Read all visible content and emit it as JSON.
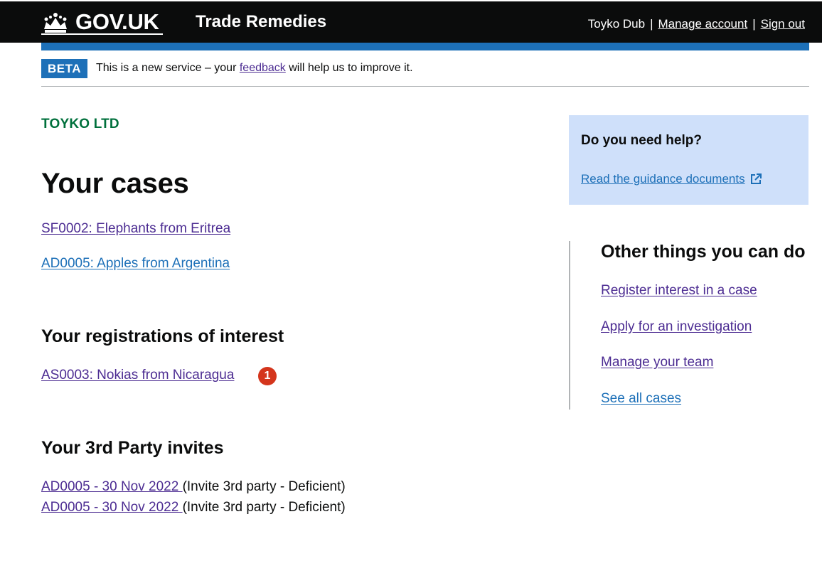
{
  "header": {
    "logo_text": "GOV.UK",
    "service_name": "Trade Remedies",
    "user_name": "Toyko Dub",
    "manage_account": "Manage account",
    "sign_out": "Sign out",
    "separator": "|"
  },
  "phase_banner": {
    "tag": "BETA",
    "text_before": "This is a new service – your ",
    "link": "feedback",
    "text_after": " will help us to improve it."
  },
  "organisation": "TOYKO LTD",
  "page_title": "Your cases",
  "cases": [
    {
      "label": "SF0002: Elephants from Eritrea",
      "visited": true
    },
    {
      "label": "AD0005: Apples from Argentina",
      "visited": false
    }
  ],
  "registrations": {
    "heading": "Your registrations of interest",
    "items": [
      {
        "label": "AS0003: Nokias from Nicaragua",
        "badge": "1"
      }
    ]
  },
  "invites": {
    "heading": "Your 3rd Party invites",
    "items": [
      {
        "link": "AD0005 - 30 Nov 2022 ",
        "status": "(Invite 3rd party - Deficient)"
      },
      {
        "link": "AD0005 - 30 Nov 2022 ",
        "status": "(Invite 3rd party - Deficient)"
      }
    ]
  },
  "help": {
    "title": "Do you need help?",
    "link": "Read the guidance documents",
    "icon": "external-link-icon"
  },
  "other_things": {
    "heading": "Other things you can do",
    "links": [
      {
        "label": "Register interest in a case",
        "visited": true
      },
      {
        "label": "Apply for an investigation",
        "visited": true
      },
      {
        "label": "Manage your team",
        "visited": true
      },
      {
        "label": "See all cases",
        "visited": false
      }
    ]
  },
  "colors": {
    "header_bg": "#0b0c0c",
    "brand_blue": "#1d70b8",
    "link_visited": "#4c2c92",
    "org_green": "#00703c",
    "help_bg": "#cfe0fa",
    "badge_red": "#d4351c"
  }
}
